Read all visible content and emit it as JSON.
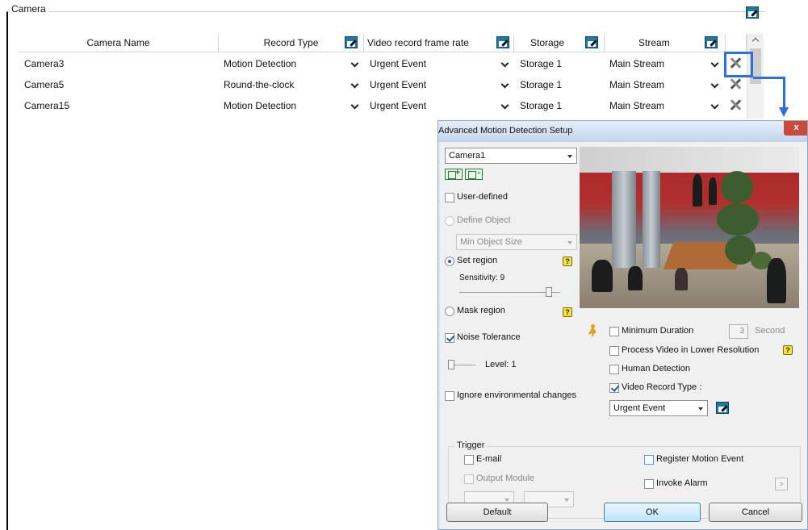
{
  "camera_group": {
    "title": "Camera"
  },
  "table": {
    "columns": {
      "camera_name": "Camera Name",
      "record_type": "Record Type",
      "frame_rate": "Video record frame rate",
      "storage": "Storage",
      "stream": "Stream"
    },
    "rows": [
      {
        "camera": "Camera3",
        "record_type": "Motion Detection",
        "frame_rate": "Urgent Event",
        "storage": "Storage 1",
        "stream": "Main Stream"
      },
      {
        "camera": "Camera5",
        "record_type": "Round-the-clock",
        "frame_rate": "Urgent Event",
        "storage": "Storage 1",
        "stream": "Main Stream"
      },
      {
        "camera": "Camera15",
        "record_type": "Motion Detection",
        "frame_rate": "Urgent Event",
        "storage": "Storage 1",
        "stream": "Main Stream"
      }
    ]
  },
  "dialog": {
    "title": "Advanced Motion Detection Setup",
    "close_label": "x",
    "camera_select": "Camera1",
    "user_defined": "User-defined",
    "define_object": "Define Object",
    "min_object_size": "Min Object Size",
    "set_region": "Set region",
    "sensitivity": "Sensitivity: 9",
    "mask_region": "Mask region",
    "noise_tolerance": "Noise Tolerance",
    "level": "Level: 1",
    "ignore_env": "Ignore environmental changes",
    "minimum_duration": "Minimum Duration",
    "duration_value": "3",
    "duration_unit": "Second",
    "process_lower_res": "Process Video in Lower Resolution",
    "human_detection": "Human Detection",
    "video_record_type": "Video Record Type :",
    "record_type_value": "Urgent Event",
    "trigger": "Trigger",
    "email": "E-mail",
    "register_motion_event": "Register Motion Event",
    "output_module": "Output Module",
    "invoke_alarm": "Invoke Alarm",
    "invoke_arrow": ">",
    "help_glyph": "?",
    "default_button": "Default",
    "ok_button": "OK",
    "cancel_button": "Cancel",
    "states": {
      "user_defined": false,
      "set_region": true,
      "mask_region": false,
      "noise_tolerance": true,
      "ignore_env": false,
      "minimum_duration": false,
      "process_lower_res": false,
      "human_detection": false,
      "video_record_type": true,
      "email": false,
      "register_motion_event": false,
      "invoke_alarm": false
    }
  },
  "colors": {
    "highlight": "#2f6fd6",
    "dialog_border": "#8ba7cc",
    "close_button": "#c84a3a"
  }
}
